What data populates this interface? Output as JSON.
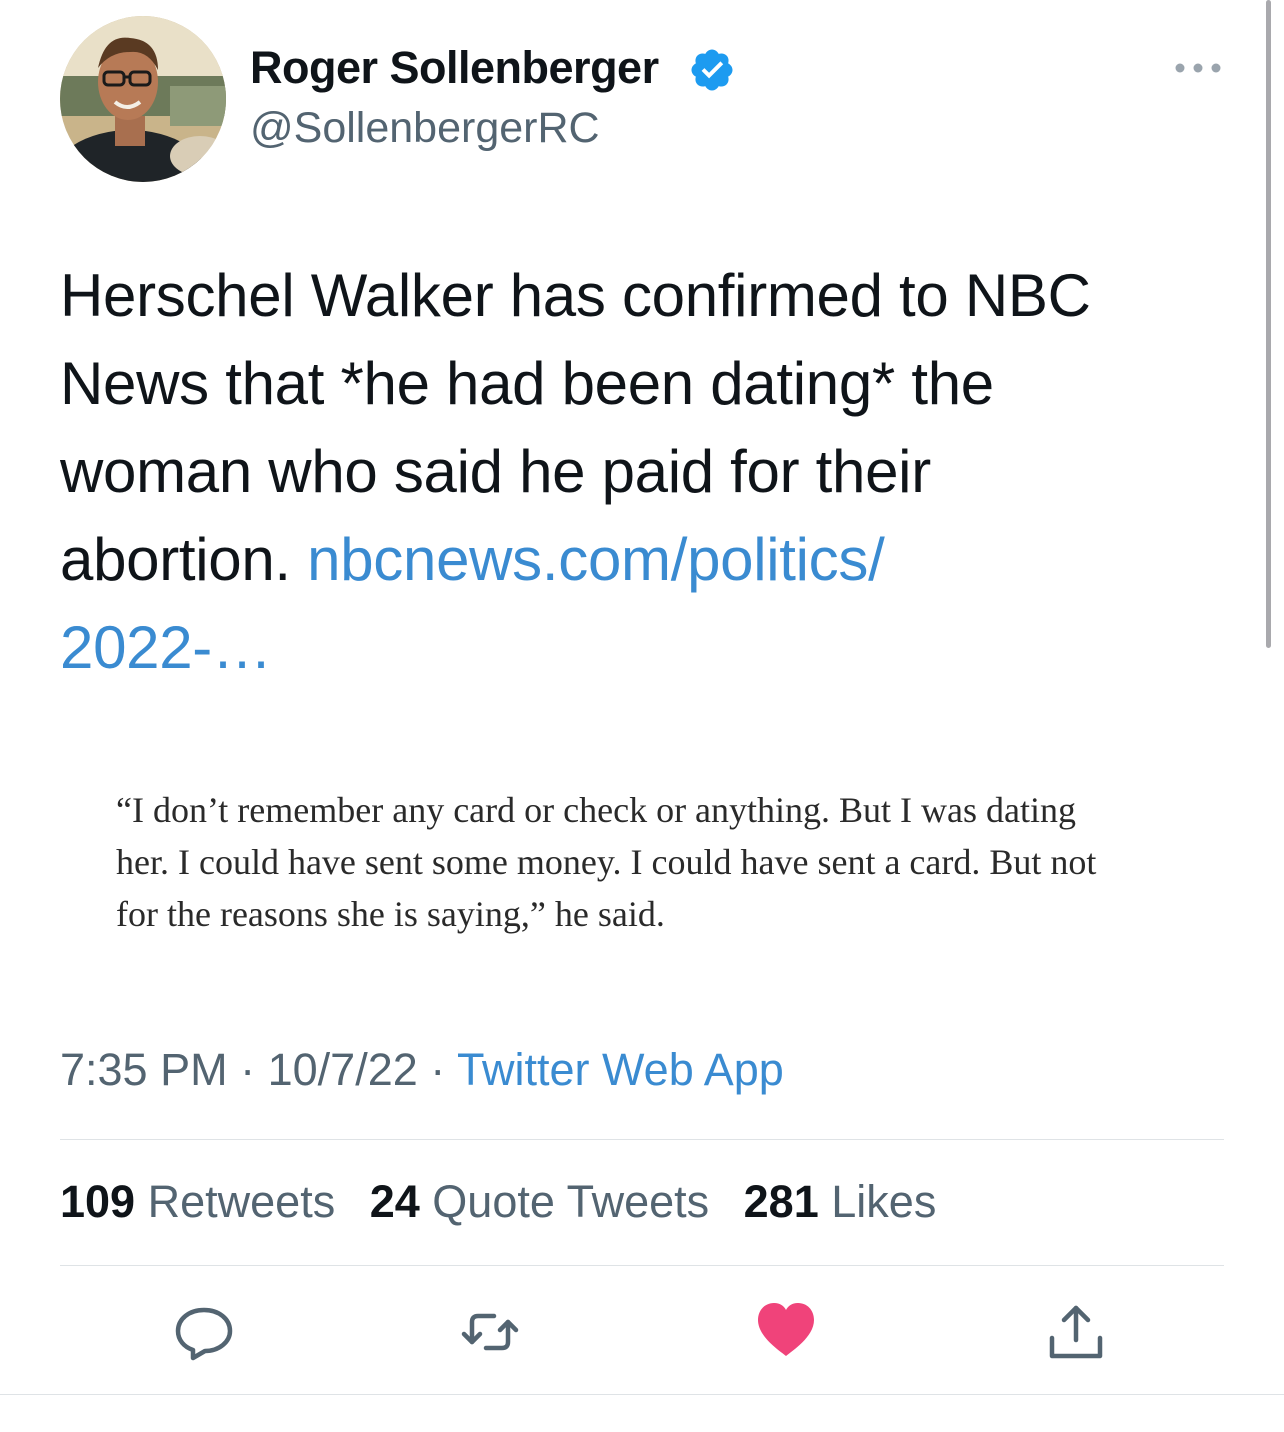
{
  "tweet": {
    "author": {
      "name": "Roger Sollenberger",
      "handle": "@SollenbergerRC",
      "verified": true
    },
    "text_lines": [
      "Herschel Walker has confirmed to NBC",
      "News that *he had been dating* the",
      "woman who said he paid for their",
      "abortion. "
    ],
    "link_part1": "nbcnews.com/politics/",
    "link_part2": "2022-…",
    "quote_image_lines": [
      "“I don’t remember any card or check or anything. But I was dating",
      "her. I could have sent some money. I could have sent a card. But not",
      "for the reasons she is saying,” he said."
    ],
    "time": "7:35 PM",
    "date": "10/7/22",
    "separator": "·",
    "source": "Twitter Web App",
    "stats": {
      "retweets_count": "109",
      "retweets_label": "Retweets",
      "quotes_count": "24",
      "quotes_label": "Quote Tweets",
      "likes_count": "281",
      "likes_label": "Likes"
    }
  },
  "icons": {
    "more": "more-dots-icon",
    "reply": "reply-icon",
    "retweet": "retweet-icon",
    "like": "heart-icon",
    "share": "share-icon"
  },
  "colors": {
    "link": "#3a8bd1",
    "verified": "#1d9bf0",
    "liked": "#f0437a",
    "secondary_text": "#536471"
  }
}
